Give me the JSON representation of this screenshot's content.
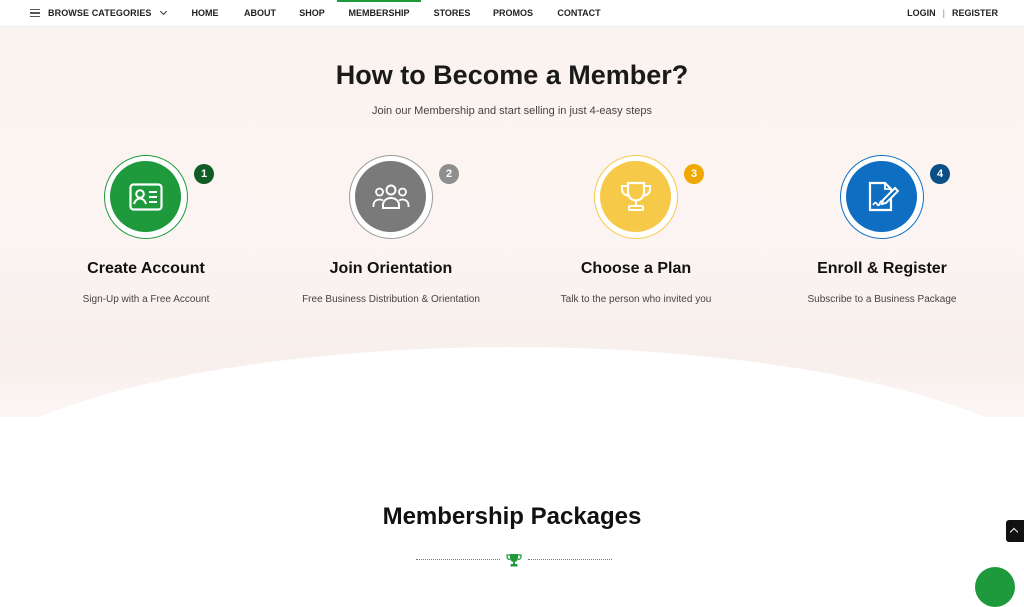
{
  "nav": {
    "browse_label": "BROWSE CATEGORIES",
    "items": [
      "HOME",
      "ABOUT",
      "SHOP",
      "MEMBERSHIP",
      "STORES",
      "PROMOS",
      "CONTACT"
    ],
    "active": "MEMBERSHIP",
    "login": "LOGIN",
    "separator": "|",
    "register": "REGISTER",
    "accent_color": "#1e9a3c"
  },
  "hero": {
    "title": "How to Become a Member?",
    "subtitle": "Join our Membership and start selling in just 4-easy steps"
  },
  "steps": [
    {
      "number": "1",
      "title": "Create Account",
      "description": "Sign-Up with a Free Account",
      "icon": "id-card-icon",
      "color": "#1e9a3c",
      "badge_color": "#0f5c27"
    },
    {
      "number": "2",
      "title": "Join Orientation",
      "description": "Free Business Distribution & Orientation",
      "icon": "users-group-icon",
      "color": "#7a7a7a",
      "badge_color": "#8e8e8e"
    },
    {
      "number": "3",
      "title": "Choose a Plan",
      "description": "Talk to the person who invited you",
      "icon": "trophy-icon",
      "color": "#f7c948",
      "badge_color": "#f0a800"
    },
    {
      "number": "4",
      "title": "Enroll & Register",
      "description": "Subscribe to a Business Package",
      "icon": "signed-document-icon",
      "color": "#0e6fc2",
      "badge_color": "#0b4f86"
    }
  ],
  "packages": {
    "title": "Membership Packages",
    "divider_icon": "trophy-icon",
    "divider_color": "#1e9a3c"
  }
}
